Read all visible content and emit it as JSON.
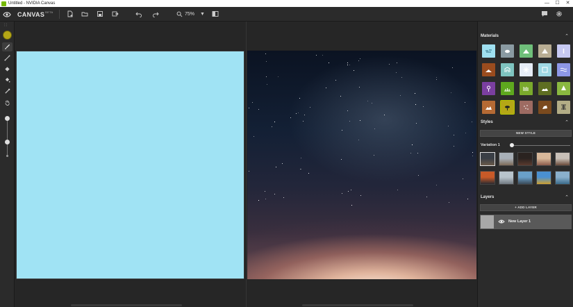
{
  "window": {
    "title": "Untitled - NVIDIA Canvas"
  },
  "app": {
    "brand": "CANVAS",
    "brand_badge": "BETA"
  },
  "toolbar": {
    "zoom": "75%"
  },
  "colors": {
    "canvas_fill": "#a0e3f4",
    "accent": "#b5c400",
    "active_material": "#b5a716"
  },
  "tools": [
    "material-picker-icon",
    "brush-icon",
    "line-icon",
    "eraser-icon",
    "fill-bucket-icon",
    "eyedropper-icon",
    "pan-hand-icon"
  ],
  "brush": {
    "size_level": 0.55
  },
  "panel": {
    "materials_title": "Materials",
    "styles_title": "Styles",
    "new_style_label": "NEW STYLE",
    "variation_label": "Variation 1",
    "layers_title": "Layers",
    "add_layer_label": "+ ADD LAYER",
    "layer_name": "New Layer 1"
  },
  "materials": [
    {
      "name": "sky",
      "color": "#9fe0f0",
      "icon": "sky-icon"
    },
    {
      "name": "cloud",
      "color": "#8a9aa2",
      "icon": "cloud-icon"
    },
    {
      "name": "mountain",
      "color": "#6fbf7a",
      "icon": "mountain-icon"
    },
    {
      "name": "hill",
      "color": "#b8ad93",
      "icon": "hill-icon"
    },
    {
      "name": "fog",
      "color": "#c6c9f2",
      "icon": "fog-icon"
    },
    {
      "name": "dirt",
      "color": "#9a4c1e",
      "icon": "dirt-icon"
    },
    {
      "name": "building",
      "color": "#7fc4c0",
      "icon": "building-icon"
    },
    {
      "name": "snow",
      "color": "#e6ecf6",
      "icon": "snow-icon"
    },
    {
      "name": "ice",
      "color": "#9fd8e4",
      "icon": "ice-icon"
    },
    {
      "name": "water",
      "color": "#8d97e6",
      "icon": "water-icon"
    },
    {
      "name": "flower",
      "color": "#7b3fa0",
      "icon": "flower-icon"
    },
    {
      "name": "grass",
      "color": "#5ea81e",
      "icon": "grass-icon"
    },
    {
      "name": "straw",
      "color": "#7aaa2c",
      "icon": "straw-icon"
    },
    {
      "name": "bush",
      "color": "#5e6e22",
      "icon": "bush-icon"
    },
    {
      "name": "tree",
      "color": "#8ab840",
      "icon": "tree-icon"
    },
    {
      "name": "rock",
      "color": "#b56a34",
      "icon": "rock-icon"
    },
    {
      "name": "sand",
      "color": "#b5a716",
      "icon": "sand-icon"
    },
    {
      "name": "gravel",
      "color": "#9d6b62",
      "icon": "gravel-icon"
    },
    {
      "name": "stone",
      "color": "#7a4a1e",
      "icon": "stone-icon"
    },
    {
      "name": "wall",
      "color": "#b3ad86",
      "icon": "wall-icon"
    }
  ],
  "active_material_index": 16,
  "variation": {
    "value": 0.0
  },
  "styles": [
    {
      "name": "style-1",
      "top": "#3a3f46",
      "bottom": "#6a5a4a"
    },
    {
      "name": "style-2",
      "top": "#a8b0b8",
      "bottom": "#7d6a58"
    },
    {
      "name": "style-3",
      "top": "#2a2320",
      "bottom": "#5a3a2e"
    },
    {
      "name": "style-4",
      "top": "#d8b89a",
      "bottom": "#8a5a4a"
    },
    {
      "name": "style-5",
      "top": "#c8c0b8",
      "bottom": "#6a4a3a"
    },
    {
      "name": "style-6",
      "top": "#c85a28",
      "bottom": "#2a2a30"
    },
    {
      "name": "style-7",
      "top": "#b8c4cc",
      "bottom": "#707880"
    },
    {
      "name": "style-8",
      "top": "#6aa0c8",
      "bottom": "#3a4a58"
    },
    {
      "name": "style-9",
      "top": "#4a90d0",
      "bottom": "#d0a030"
    },
    {
      "name": "style-10",
      "top": "#8ab0cc",
      "bottom": "#3a6a8a"
    }
  ],
  "active_style_index": 0
}
